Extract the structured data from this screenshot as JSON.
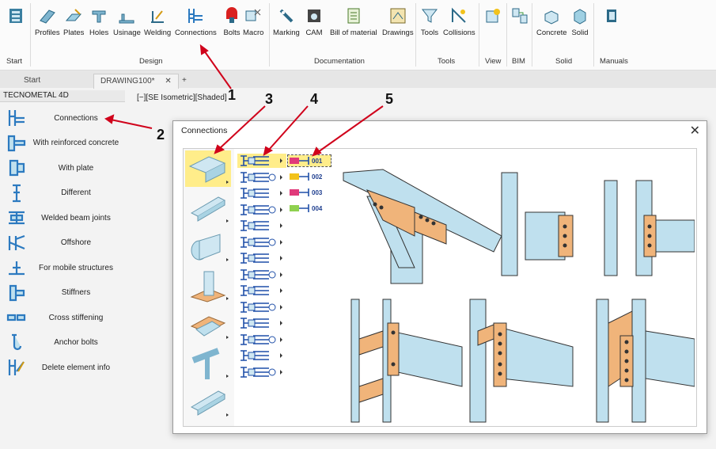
{
  "ribbon": {
    "start": {
      "label": "Start",
      "group": "Start"
    },
    "design": {
      "group": "Design",
      "buttons": [
        "Profiles",
        "Plates",
        "Holes",
        "Usinage",
        "Welding",
        "Connections",
        "Bolts",
        "Macro"
      ]
    },
    "documentation": {
      "group": "Documentation",
      "buttons": [
        "Marking",
        "CAM",
        "Bill of material",
        "Drawings"
      ]
    },
    "tools": {
      "group": "Tools",
      "buttons": [
        "Tools",
        "Collisions"
      ]
    },
    "view": {
      "group": "View"
    },
    "bim": {
      "group": "BIM"
    },
    "solid": {
      "group": "Solid",
      "buttons": [
        "Concrete",
        "Solid"
      ]
    },
    "manuals": {
      "group": "Manuals"
    }
  },
  "tabs": {
    "start": "Start",
    "drawing": "DRAWING100*",
    "close": "✕",
    "add": "+"
  },
  "sidebar": {
    "title": "TECNOMETAL 4D",
    "items": [
      {
        "label": "Connections",
        "icon": "connections-icon"
      },
      {
        "label": "With reinforced concrete",
        "icon": "reinforced-concrete-icon"
      },
      {
        "label": "With plate",
        "icon": "plate-icon"
      },
      {
        "label": "Different",
        "icon": "different-icon"
      },
      {
        "label": "Welded beam joints",
        "icon": "welded-beam-icon"
      },
      {
        "label": "Offshore",
        "icon": "offshore-icon"
      },
      {
        "label": "For mobile structures",
        "icon": "mobile-structures-icon"
      },
      {
        "label": "Stiffners",
        "icon": "stiffners-icon"
      },
      {
        "label": "Cross stiffening",
        "icon": "cross-stiffening-icon"
      },
      {
        "label": "Anchor bolts",
        "icon": "anchor-bolts-icon"
      },
      {
        "label": "Delete element info",
        "icon": "delete-info-icon"
      }
    ]
  },
  "viewport": {
    "title": "[−][SE Isometric][Shaded]"
  },
  "dialog": {
    "title": "Connections",
    "close": "✕",
    "subtypes": [
      "001",
      "002",
      "003",
      "004"
    ]
  },
  "annotations": [
    "1",
    "2",
    "3",
    "4",
    "5"
  ],
  "colors": {
    "accent": "#2b6cb0",
    "selection": "#ffed8a",
    "steel": "#b9dbe6",
    "plate": "#f0b47a"
  }
}
